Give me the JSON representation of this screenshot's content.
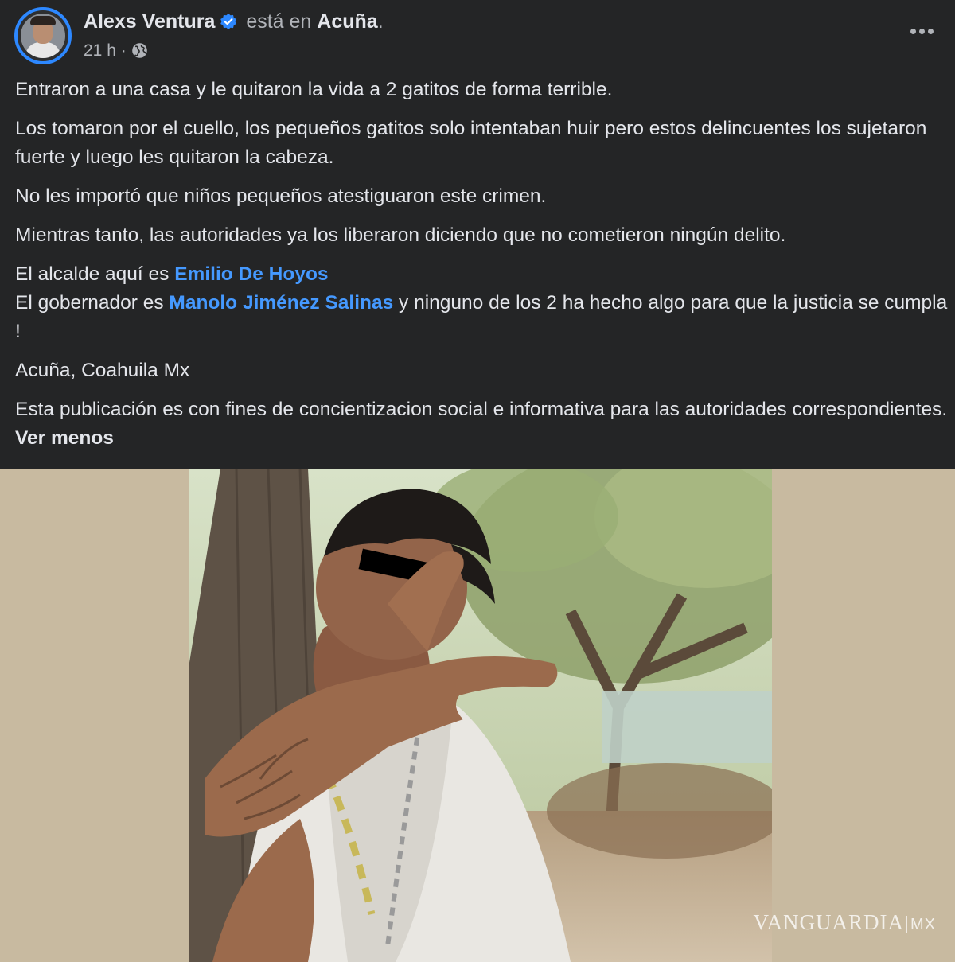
{
  "post": {
    "author": "Alexs Ventura",
    "location_prefix": "está en",
    "location": "Acuña",
    "location_suffix": ".",
    "timestamp": "21 h",
    "separator": "·",
    "audience_icon": "globe-icon",
    "verified_icon": "verified-badge-icon",
    "more_icon": "more-options-icon",
    "paragraphs": {
      "p1": "Entraron a una casa y le quitaron la vida a 2 gatitos de forma terrible.",
      "p2": "Los tomaron por el cuello, los pequeños gatitos solo intentaban huir pero estos delincuentes los sujetaron fuerte y luego les quitaron la cabeza.",
      "p3": "No les importó que niños pequeños atestiguaron este crimen.",
      "p4": "Mientras tanto, las autoridades ya los liberaron diciendo que no cometieron ningún delito.",
      "p5_prefix": "El alcalde aquí es ",
      "p5_mention": "Emilio De Hoyos",
      "p6_prefix": "El gobernador es ",
      "p6_mention": "Manolo Jiménez Salinas",
      "p6_suffix": " y ninguno de los 2 ha hecho algo para que la justicia se cumpla !",
      "p7": "Acuña, Coahuila Mx",
      "p8": "Esta publicación es con fines de concientizacion social e informativa para las autoridades correspondientes. ",
      "see_less": "Ver menos"
    }
  },
  "media": {
    "watermark_main": "VANGUARDIA",
    "watermark_suffix": "MX"
  },
  "colors": {
    "background": "#242526",
    "text": "#e4e6eb",
    "muted": "#b0b3b8",
    "link": "#4599ff",
    "verified": "#2d88ff",
    "media_backdrop": "#c8baa0"
  }
}
